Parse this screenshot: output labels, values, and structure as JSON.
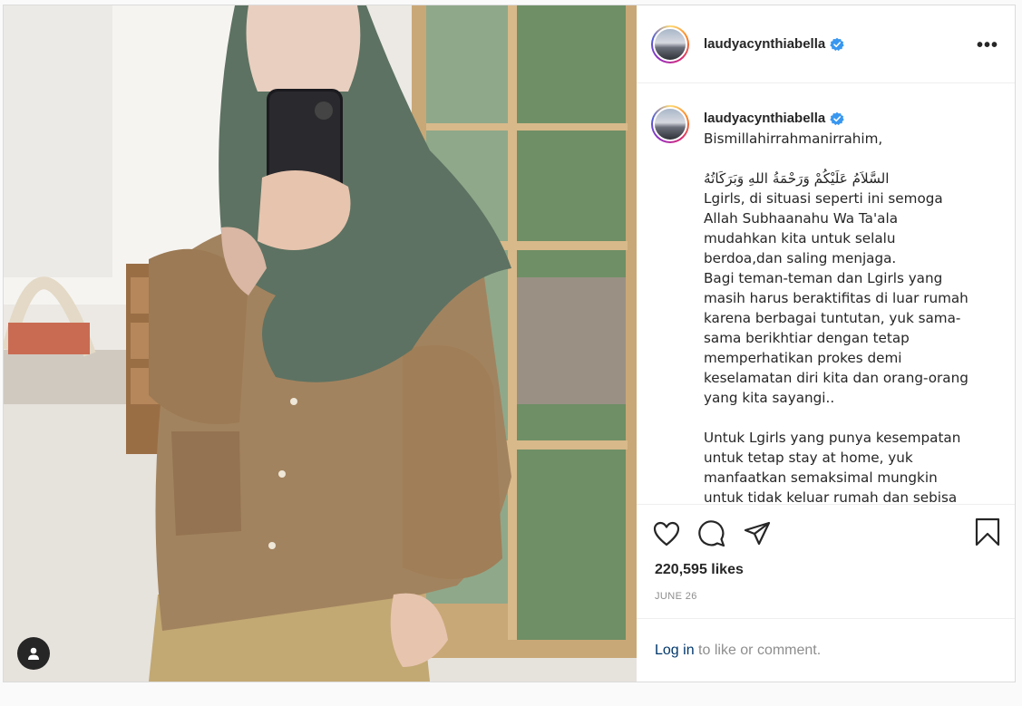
{
  "post": {
    "username": "laudyacynthiabella",
    "verified_icon": "verified-badge-icon",
    "more_icon": "more-options-icon",
    "caption": "Bismillahirrahmanirrahim,\n\nالسَّلاَمُ عَلَيْكُمْ وَرَحْمَةُ اللهِ وَبَرَكَاتُهُ\nLgirls, di situasi seperti ini semoga\nAllah Subhaanahu Wa Ta'ala\nmudahkan kita untuk selalu\nberdoa,dan saling menjaga.\nBagi teman-teman dan Lgirls yang\nmasih harus beraktifitas di luar rumah\nkarena berbagai tuntutan, yuk sama-\nsama berikhtiar dengan tetap\nmemperhatikan prokes demi\nkeselamatan diri kita dan orang-orang\nyang kita sayangi..\n\nUntuk Lgirls yang punya kesempatan\nuntuk tetap stay at home, yuk\nmanfaatkan semaksimal mungkin\nuntuk tidak keluar rumah dan sebisa",
    "likes": "220,595 likes",
    "date": "JUNE 26",
    "login_link": "Log in",
    "login_rest": " to like or comment.",
    "icons": {
      "like": "heart-icon",
      "comment": "comment-icon",
      "share": "share-icon",
      "save": "bookmark-icon",
      "user_tag": "user-tag-icon"
    }
  },
  "colors": {
    "text": "#262626",
    "muted": "#8e8e8e",
    "link": "#00376b",
    "verified": "#3897f0",
    "border": "#dbdbdb"
  }
}
